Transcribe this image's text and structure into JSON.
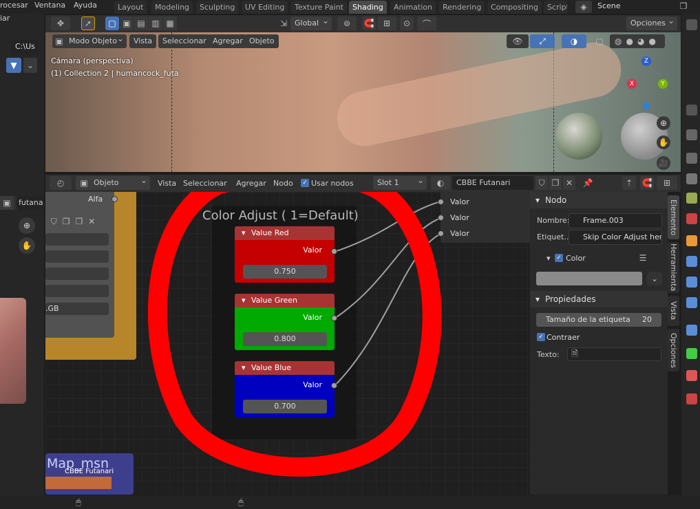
{
  "topbar": {
    "menus": [
      "rocesar",
      "Ventana",
      "Ayuda"
    ],
    "workspaces": [
      "Layout",
      "Modeling",
      "Sculpting",
      "UV Editing",
      "Texture Paint",
      "Shading",
      "Animation",
      "Rendering",
      "Compositing",
      "Script"
    ],
    "active_workspace": "Shading",
    "scene": "Scene"
  },
  "left": {
    "label_top": "iar",
    "path": "C:\\Us",
    "dropdown": "futana"
  },
  "viewport": {
    "mode": "Modo Objeto",
    "menu": [
      "Vista",
      "Seleccionar",
      "Agregar",
      "Objeto"
    ],
    "orientation": "Global",
    "options": "Opciones",
    "camera_label": "Cámara (perspectiva)",
    "collection_label": "(1) Collection 2 | humancock_futa",
    "gizmo": {
      "x": "X",
      "y": "Y",
      "z": "Z"
    }
  },
  "node_editor": {
    "type": "Objeto",
    "menu": [
      "Vista",
      "Seleccionar",
      "Agregar",
      "Nodo"
    ],
    "use_nodes_label": "Usar nodos",
    "slot": "Slot 1",
    "material": "CBBE Futanari",
    "frame_title": "Color Adjust ( 1=Default)",
    "alpha_label": "Alfa",
    "left_node_fragment": ".GB",
    "bottom_node_title": "Map_msn",
    "bottom_node_sub": "CBBE Futanari",
    "group_inputs": [
      "Valor",
      "Valor",
      "Valor"
    ],
    "nodes": [
      {
        "title": "Value Red",
        "output": "Valor",
        "value": "0.750",
        "color": "#c40000",
        "header": "#a83333"
      },
      {
        "title": "Value Green",
        "output": "Valor",
        "value": "0.800",
        "color": "#00aa00",
        "header": "#a83333"
      },
      {
        "title": "Value Blue",
        "output": "Valor",
        "value": "0.700",
        "color": "#0000c0",
        "header": "#a83333"
      }
    ]
  },
  "sidepanel": {
    "nodo_header": "Nodo",
    "name_label": "Nombre:",
    "name_value": "Frame.003",
    "label_label": "Etiquet...",
    "label_value": "Skip Color Adjust here",
    "color_label": "Color",
    "props_header": "Propiedades",
    "label_size_label": "Tamaño de la etiqueta",
    "label_size_value": "20",
    "shrink_label": "Contraer",
    "text_label": "Texto:",
    "tabs": [
      "Elemento",
      "Herramienta",
      "Vista",
      "Opciones"
    ]
  },
  "colors": {
    "annotation": "#ff0000",
    "accent": "#4772b3"
  }
}
